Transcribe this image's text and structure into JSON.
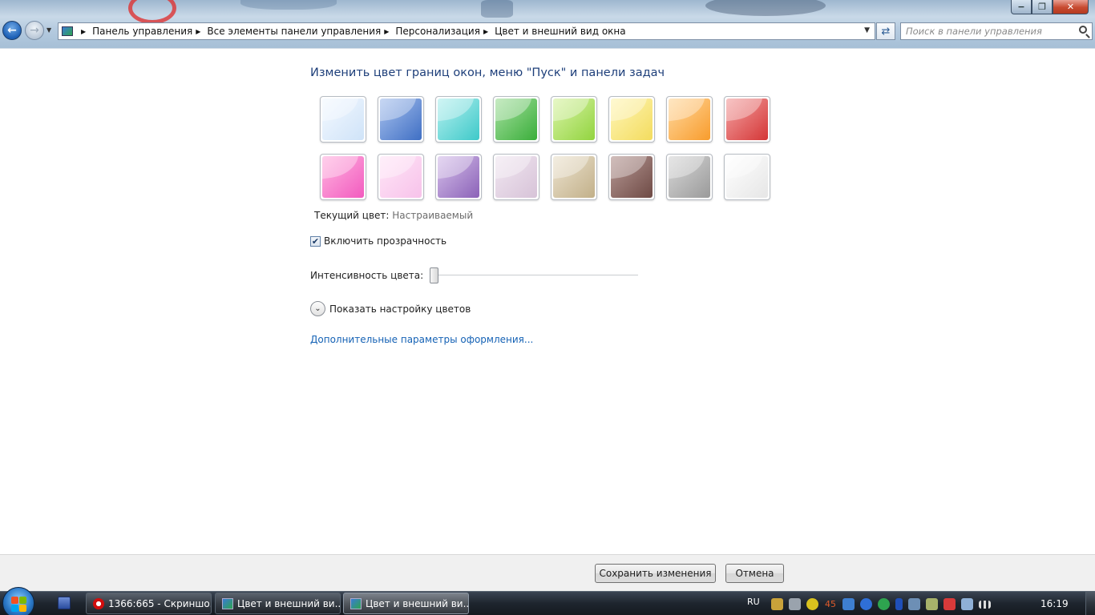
{
  "window": {
    "minimize_label": "−",
    "maximize_label": "❐",
    "close_label": "✕"
  },
  "address_bar": {
    "breadcrumbs": [
      "Панель управления",
      "Все элементы панели управления",
      "Персонализация",
      "Цвет и внешний вид окна"
    ]
  },
  "search": {
    "placeholder": "Поиск в панели управления"
  },
  "main": {
    "heading": "Изменить цвет границ окон, меню \"Пуск\" и панели задач",
    "swatches": [
      {
        "color_top": "#f4f9ff",
        "color_bottom": "#cfe3f8"
      },
      {
        "color_top": "#a9c2ee",
        "color_bottom": "#3f6fc4"
      },
      {
        "color_top": "#b5f0ef",
        "color_bottom": "#3ec9c9"
      },
      {
        "color_top": "#a6e0a0",
        "color_bottom": "#3aae3a"
      },
      {
        "color_top": "#d9f3a6",
        "color_bottom": "#92d43f"
      },
      {
        "color_top": "#fff6b8",
        "color_bottom": "#f3dc5e"
      },
      {
        "color_top": "#ffd9a0",
        "color_bottom": "#f89c2c"
      },
      {
        "color_top": "#f4a3a3",
        "color_bottom": "#d43636"
      },
      {
        "color_top": "#ffb4e0",
        "color_bottom": "#f25bbf"
      },
      {
        "color_top": "#ffe6f7",
        "color_bottom": "#f7c2ea"
      },
      {
        "color_top": "#d6c0ea",
        "color_bottom": "#8b62b8"
      },
      {
        "color_top": "#f1e7f1",
        "color_bottom": "#d7c3d8"
      },
      {
        "color_top": "#ece3d0",
        "color_bottom": "#c2b089"
      },
      {
        "color_top": "#b89a96",
        "color_bottom": "#6e4a45"
      },
      {
        "color_top": "#d8d8d8",
        "color_bottom": "#9a9a9a"
      },
      {
        "color_top": "#ffffff",
        "color_bottom": "#e6e6e6"
      }
    ],
    "current_color_label": "Текущий цвет:",
    "current_color_value": "Настраиваемый",
    "transparency_label": "Включить прозрачность",
    "transparency_checked": true,
    "intensity_label": "Интенсивность цвета:",
    "intensity_value": 0.0,
    "show_colors_label": "Показать настройку цветов",
    "advanced_link": "Дополнительные параметры оформления..."
  },
  "footer": {
    "save_label": "Сохранить изменения",
    "cancel_label": "Отмена"
  },
  "taskbar": {
    "tasks": [
      {
        "label": "1366:665 - Скриншо...",
        "icon": "opera-icon"
      },
      {
        "label": "Цвет и внешний ви...",
        "icon": "control-panel-icon"
      },
      {
        "label": "Цвет и внешний ви...",
        "icon": "control-panel-icon"
      }
    ],
    "language": "RU",
    "tray_number": "45",
    "clock": "16:19"
  },
  "colors": {
    "heading": "#1e3f7a",
    "link": "#1562b5",
    "close_button": "#c74a30"
  }
}
